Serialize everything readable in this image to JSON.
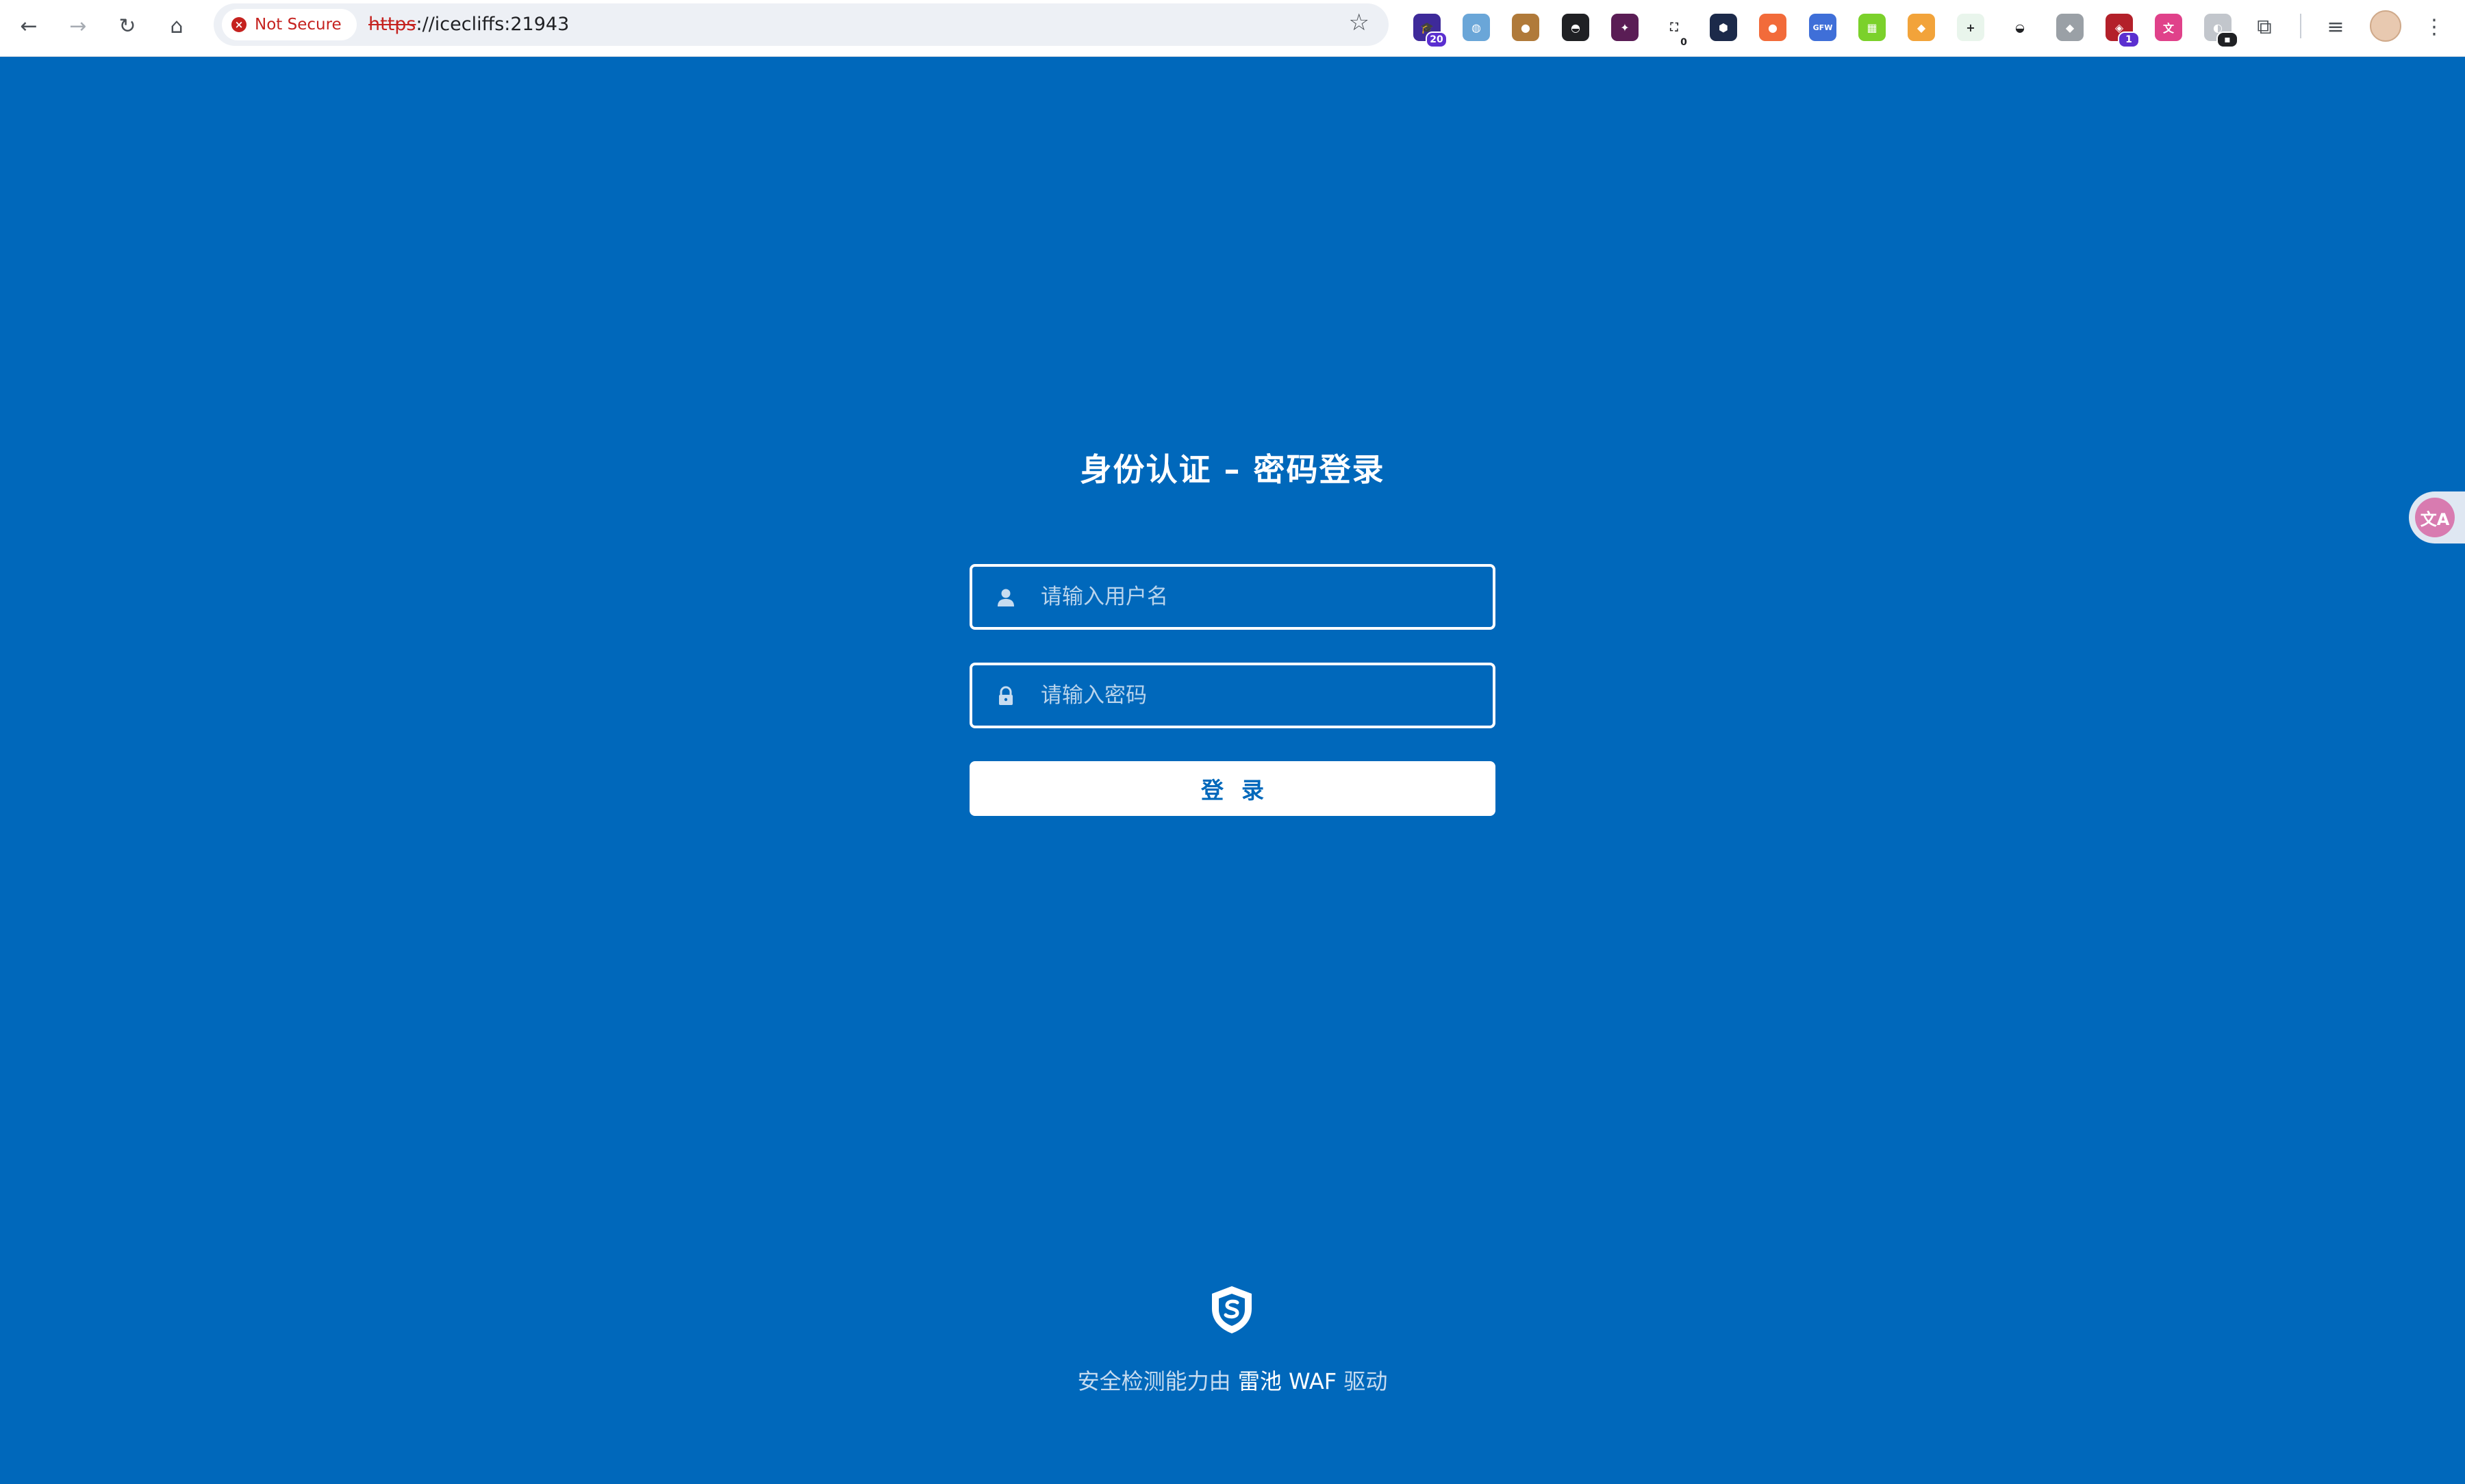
{
  "browser": {
    "security_label": "Not Secure",
    "url_scheme": "https",
    "url_rest": "://icecliffs:21943",
    "extensions": [
      {
        "name": "graduation-cap-extension-icon",
        "bg": "#3e2a9a",
        "glyph": "🎓",
        "badge": "20"
      },
      {
        "name": "globe-extension-icon",
        "bg": "#6aa6d8",
        "glyph": "◍",
        "badge": ""
      },
      {
        "name": "cookie-extension-icon",
        "bg": "#b07a3a",
        "glyph": "●",
        "badge": ""
      },
      {
        "name": "mask-extension-icon",
        "bg": "#202124",
        "glyph": "◓",
        "badge": ""
      },
      {
        "name": "purple-square-extension-icon",
        "bg": "#5a1d55",
        "glyph": "✦",
        "badge": ""
      },
      {
        "name": "screenshot-extension-icon",
        "bg": "#ffffff",
        "glyph": "⛶",
        "badge": "0"
      },
      {
        "name": "dark-hex-extension-icon",
        "bg": "#1c2a4a",
        "glyph": "⬢",
        "badge": ""
      },
      {
        "name": "orange-blob-extension-icon",
        "bg": "#f26b3a",
        "glyph": "●",
        "badge": ""
      },
      {
        "name": "gfw-extension-icon",
        "bg": "#3f6fd8",
        "glyph": "GFW",
        "badge": ""
      },
      {
        "name": "green-grid-extension-icon",
        "bg": "#7bd12b",
        "glyph": "▦",
        "badge": ""
      },
      {
        "name": "fox-extension-icon",
        "bg": "#f2a33a",
        "glyph": "◆",
        "badge": ""
      },
      {
        "name": "plus-extension-icon",
        "bg": "#e9f5ec",
        "glyph": "+",
        "badge": ""
      },
      {
        "name": "hat-extension-icon",
        "bg": "#ffffff",
        "glyph": "◒",
        "badge": ""
      },
      {
        "name": "puzzle-gray-extension-icon",
        "bg": "#9aa0a6",
        "glyph": "◆",
        "badge": ""
      },
      {
        "name": "red-shield-extension-icon",
        "bg": "#b3202a",
        "glyph": "◈",
        "badge": "1"
      },
      {
        "name": "pink-translate-extension-icon",
        "bg": "#e0418a",
        "glyph": "文",
        "badge": ""
      },
      {
        "name": "gray-ext-extension-icon",
        "bg": "#c2c6cc",
        "glyph": "◐",
        "badge": "▪"
      }
    ]
  },
  "login": {
    "title": "身份认证 – 密码登录",
    "username_placeholder": "请输入用户名",
    "password_placeholder": "请输入密码",
    "submit_label": "登录"
  },
  "footer": {
    "prefix": "安全检测能力由",
    "brand": "雷池 WAF",
    "suffix": "驱动"
  },
  "theme": {
    "background": "#0068bb",
    "foreground": "#ffffff"
  },
  "translate_widget": {
    "label": "文A"
  }
}
